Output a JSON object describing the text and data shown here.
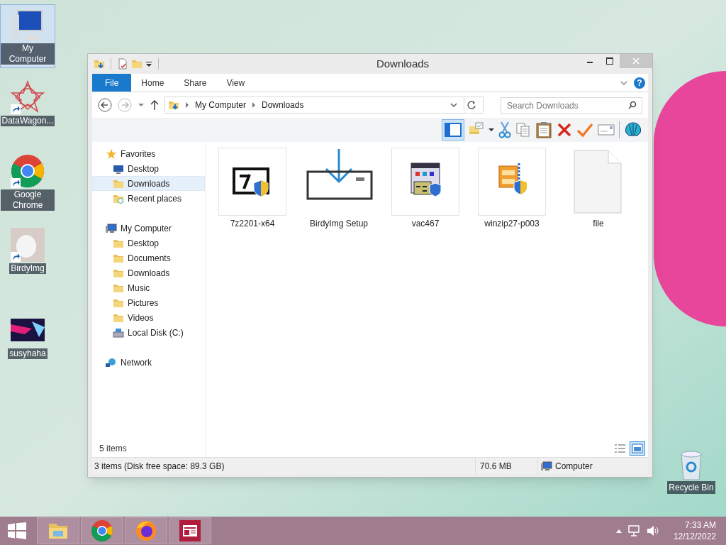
{
  "desktop_icons": [
    {
      "label": "My Computer",
      "kind": "computer",
      "shortcut": false,
      "selected": true
    },
    {
      "label": "DataWagon...",
      "kind": "star",
      "shortcut": true,
      "selected": false
    },
    {
      "label": "Google Chrome",
      "kind": "chrome",
      "shortcut": true,
      "selected": false
    },
    {
      "label": "BirdyImg",
      "kind": "photo",
      "shortcut": true,
      "selected": false
    },
    {
      "label": "susyhaha",
      "kind": "video",
      "shortcut": false,
      "selected": false
    }
  ],
  "recycle_bin": {
    "label": "Recycle Bin"
  },
  "window": {
    "title": "Downloads",
    "ribbon_tabs": [
      {
        "label": "File",
        "selected": true
      },
      {
        "label": "Home",
        "selected": false
      },
      {
        "label": "Share",
        "selected": false
      },
      {
        "label": "View",
        "selected": false
      }
    ],
    "address": [
      "My Computer",
      "Downloads"
    ],
    "search": {
      "placeholder": "Search Downloads"
    },
    "help": "?",
    "nav": [
      {
        "label": "Favorites",
        "kind": "star",
        "selected": false,
        "children": [
          {
            "label": "Desktop",
            "kind": "desktop",
            "selected": false
          },
          {
            "label": "Downloads",
            "kind": "folder",
            "selected": true
          },
          {
            "label": "Recent places",
            "kind": "recent",
            "selected": false
          }
        ]
      },
      {
        "label": "My Computer",
        "kind": "computer",
        "selected": false,
        "children": [
          {
            "label": "Desktop",
            "kind": "folder",
            "selected": false
          },
          {
            "label": "Documents",
            "kind": "folder",
            "selected": false
          },
          {
            "label": "Downloads",
            "kind": "folder",
            "selected": false
          },
          {
            "label": "Music",
            "kind": "folder",
            "selected": false
          },
          {
            "label": "Pictures",
            "kind": "folder",
            "selected": false
          },
          {
            "label": "Videos",
            "kind": "folder",
            "selected": false
          },
          {
            "label": "Local Disk (C:)",
            "kind": "disk",
            "selected": false
          }
        ]
      },
      {
        "label": "Network",
        "kind": "network",
        "selected": false
      }
    ],
    "files": [
      {
        "name": "7z2201-x64",
        "kind": "sevenzip"
      },
      {
        "name": "BirdyImg Setup",
        "kind": "download"
      },
      {
        "name": "vac467",
        "kind": "installer"
      },
      {
        "name": "winzip27-p003",
        "kind": "winzip"
      },
      {
        "name": "file",
        "kind": "blank"
      }
    ],
    "item_count": "5 items",
    "status": {
      "selection": "3 items (Disk free space: 89.3 GB)",
      "size": "70.6 MB",
      "location": "Computer"
    }
  },
  "taskbar": {
    "apps": [
      {
        "kind": "explorer"
      },
      {
        "kind": "chrome"
      },
      {
        "kind": "firefox"
      },
      {
        "kind": "news"
      }
    ],
    "time": "7:33 AM",
    "date": "12/12/2022"
  }
}
